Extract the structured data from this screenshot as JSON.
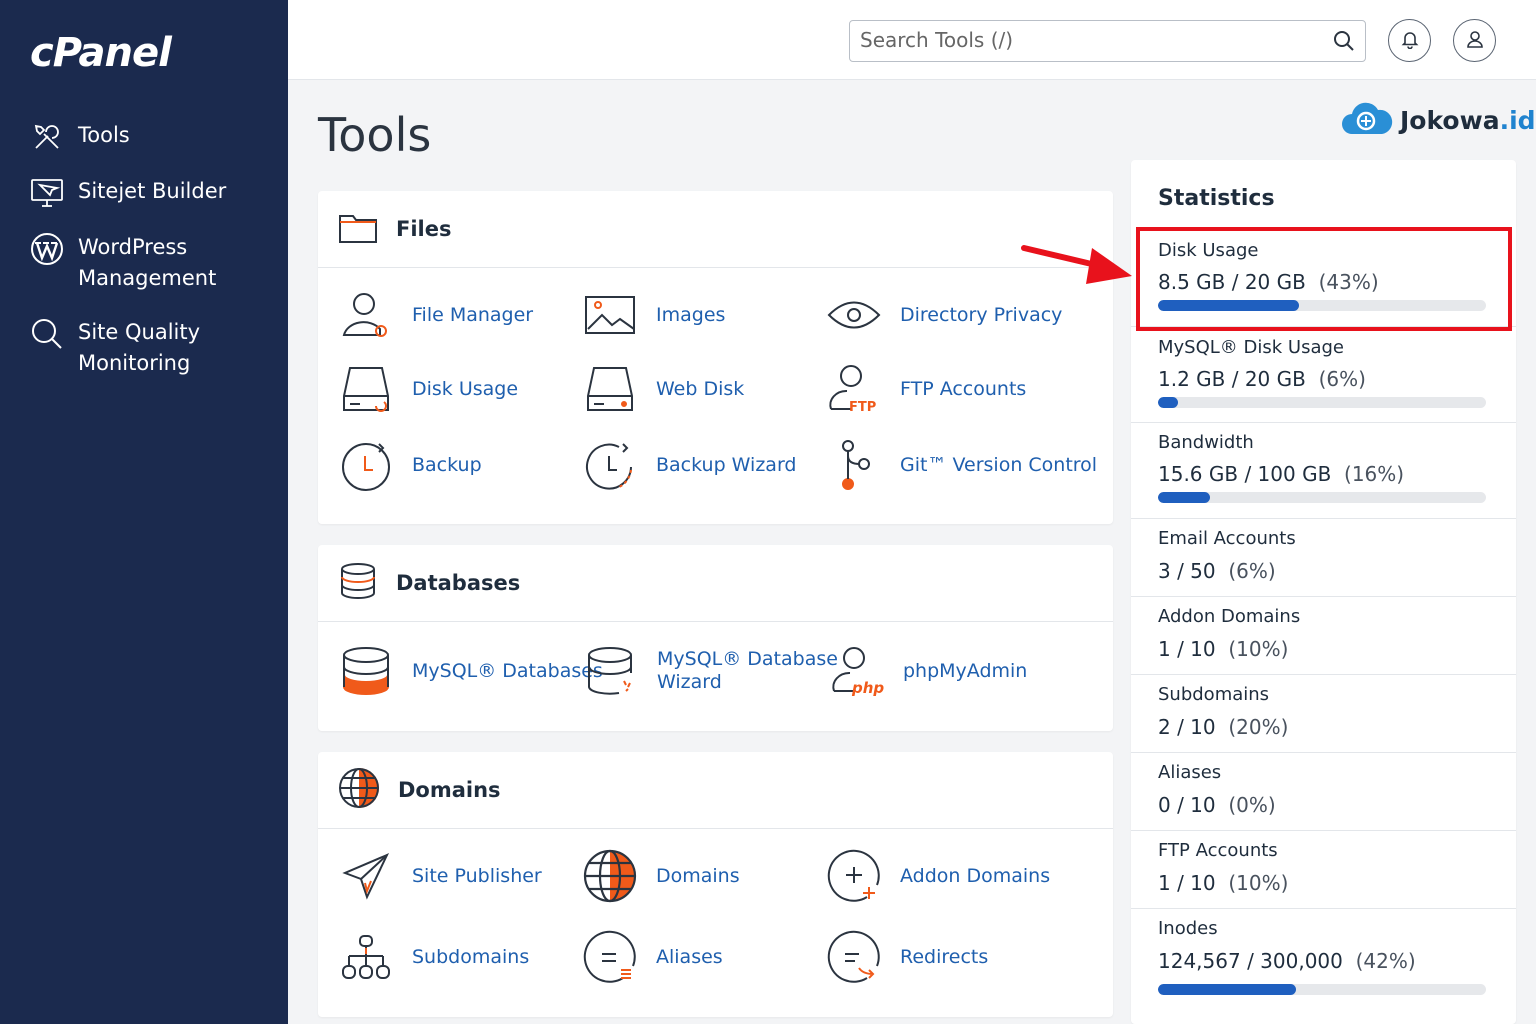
{
  "sidebar": {
    "logo": "cPanel",
    "items": [
      {
        "label": "Tools",
        "icon": "tools-icon"
      },
      {
        "label": "Sitejet Builder",
        "icon": "sitejet-icon"
      },
      {
        "label": "WordPress\nManagement",
        "icon": "wordpress-icon"
      },
      {
        "label": "Site Quality\nMonitoring",
        "icon": "search-icon"
      }
    ]
  },
  "header": {
    "search_placeholder": "Search Tools (/)"
  },
  "page": {
    "title": "Tools",
    "brand_name": "Jokowa",
    "brand_suffix": ".id"
  },
  "sections": {
    "files": {
      "title": "Files",
      "tools": [
        "File Manager",
        "Images",
        "Directory Privacy",
        "Disk Usage",
        "Web Disk",
        "FTP Accounts",
        "Backup",
        "Backup Wizard",
        "Git™ Version Control"
      ]
    },
    "databases": {
      "title": "Databases",
      "tools": [
        "MySQL® Databases",
        "MySQL® Database\nWizard",
        "phpMyAdmin"
      ]
    },
    "domains": {
      "title": "Domains",
      "tools": [
        "Site Publisher",
        "Domains",
        "Addon Domains",
        "Subdomains",
        "Aliases",
        "Redirects"
      ]
    }
  },
  "statistics": {
    "title": "Statistics",
    "items": [
      {
        "label": "Disk Usage",
        "value": "8.5 GB / 20 GB",
        "pct": "(43%)",
        "fraction": 0.43,
        "bar": true
      },
      {
        "label": "MySQL® Disk Usage",
        "value": "1.2 GB / 20 GB",
        "pct": "(6%)",
        "fraction": 0.06,
        "bar": true
      },
      {
        "label": "Bandwidth",
        "value": "15.6 GB / 100 GB",
        "pct": "(16%)",
        "fraction": 0.16,
        "bar": true
      },
      {
        "label": "Email Accounts",
        "value": "3 / 50",
        "pct": "(6%)"
      },
      {
        "label": "Addon Domains",
        "value": "1 / 10",
        "pct": "(10%)"
      },
      {
        "label": "Subdomains",
        "value": "2 / 10",
        "pct": "(20%)"
      },
      {
        "label": "Aliases",
        "value": "0 / 10",
        "pct": "(0%)"
      },
      {
        "label": "FTP Accounts",
        "value": "1 / 10",
        "pct": "(10%)"
      },
      {
        "label": "Inodes",
        "value": "124,567 / 300,000",
        "pct": "(42%)",
        "fraction": 0.42,
        "bar": true
      }
    ]
  },
  "colors": {
    "sidebar": "#1b2a4e",
    "link": "#1f5fae",
    "accent_orange": "#f05a1a",
    "bar_fill": "#1f5fbf",
    "highlight": "#e8121c"
  }
}
